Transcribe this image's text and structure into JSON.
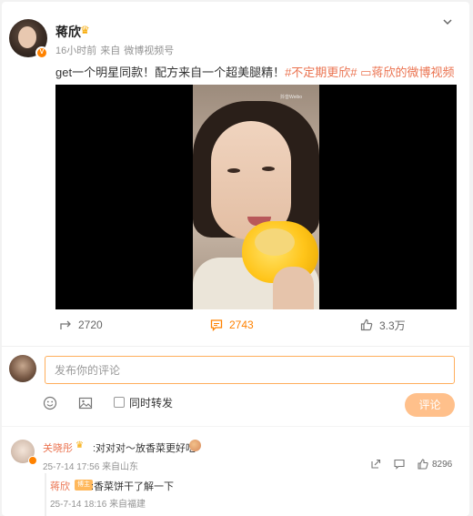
{
  "post": {
    "author": "蒋欣",
    "time": "16小时前",
    "source_prefix": "来自",
    "source": "微博视频号",
    "text": "get一个明星同款！配方来自一个超美腿精！",
    "tag1": "#不定期更欣#",
    "tag2": "蒋欣的微博视频",
    "video_watermark": "抖音Weibo"
  },
  "actions": {
    "repost": "2720",
    "comment": "2743",
    "like": "3.3万"
  },
  "composer": {
    "placeholder": "发布你的评论",
    "repost_label": "同时转发",
    "submit": "评论"
  },
  "comment": {
    "author": "关晓彤",
    "text": ":对对对～放香菜更好吃",
    "date": "25-7-14 17:56",
    "location": "来自山东",
    "likes": "8296"
  },
  "reply": {
    "author": "蒋欣",
    "badge": "博主",
    "text": ":香菜饼干了解一下",
    "date": "25-7-14 18:16",
    "location": "来自福建"
  },
  "colors": {
    "accent": "#ff8200",
    "link": "#eb7350",
    "submit_disabled": "#ffc08b"
  }
}
